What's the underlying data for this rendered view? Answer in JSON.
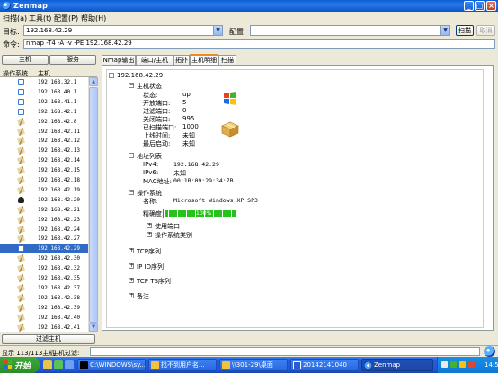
{
  "window": {
    "title": "Zenmap"
  },
  "menu": [
    "扫描(a)",
    "工具(t)",
    "配置(P)",
    "帮助(H)"
  ],
  "toolbar": {
    "target_label": "目标:",
    "target_value": "192.168.42.29",
    "profile_label": "配置:",
    "profile_value": "",
    "scan_button": "扫描",
    "cancel_button": "取消",
    "command_label": "命令:",
    "command_value": "nmap -T4 -A -v -PE 192.168.42.29"
  },
  "left_panel": {
    "hosts_button": "主机",
    "services_button": "服务",
    "col_os": "操作系统",
    "col_host": "主机",
    "filter_button": "过滤主机",
    "hosts": [
      {
        "ip": "192.168.32.1",
        "os": "windows"
      },
      {
        "ip": "192.168.40.1",
        "os": "windows"
      },
      {
        "ip": "192.168.41.1",
        "os": "windows"
      },
      {
        "ip": "192.168.42.1",
        "os": "windows"
      },
      {
        "ip": "192.168.42.8",
        "os": "unknown"
      },
      {
        "ip": "192.168.42.11",
        "os": "unknown"
      },
      {
        "ip": "192.168.42.12",
        "os": "unknown"
      },
      {
        "ip": "192.168.42.13",
        "os": "unknown"
      },
      {
        "ip": "192.168.42.14",
        "os": "unknown"
      },
      {
        "ip": "192.168.42.15",
        "os": "unknown"
      },
      {
        "ip": "192.168.42.18",
        "os": "unknown"
      },
      {
        "ip": "192.168.42.19",
        "os": "unknown"
      },
      {
        "ip": "192.168.42.20",
        "os": "linux"
      },
      {
        "ip": "192.168.42.21",
        "os": "unknown"
      },
      {
        "ip": "192.168.42.23",
        "os": "unknown"
      },
      {
        "ip": "192.168.42.24",
        "os": "unknown"
      },
      {
        "ip": "192.168.42.27",
        "os": "unknown"
      },
      {
        "ip": "192.168.42.29",
        "os": "windows",
        "selected": true
      },
      {
        "ip": "192.168.42.30",
        "os": "unknown"
      },
      {
        "ip": "192.168.42.32",
        "os": "unknown"
      },
      {
        "ip": "192.168.42.35",
        "os": "unknown"
      },
      {
        "ip": "192.168.42.37",
        "os": "unknown"
      },
      {
        "ip": "192.168.42.38",
        "os": "unknown"
      },
      {
        "ip": "192.168.42.39",
        "os": "unknown"
      },
      {
        "ip": "192.168.42.40",
        "os": "unknown"
      },
      {
        "ip": "192.168.42.41",
        "os": "unknown"
      }
    ]
  },
  "tabs": [
    "Nmap输出",
    "端口/主机",
    "拓扑",
    "主机明细",
    "扫描"
  ],
  "active_tab": 3,
  "details": {
    "host": "192.168.42.29",
    "status_section": "主机状态",
    "status": [
      {
        "label": "状态:",
        "value": "up"
      },
      {
        "label": "开放端口:",
        "value": "5"
      },
      {
        "label": "过滤端口:",
        "value": "0"
      },
      {
        "label": "关闭端口:",
        "value": "995"
      },
      {
        "label": "已扫描端口:",
        "value": "1000"
      },
      {
        "label": "上线时间:",
        "value": "未知"
      },
      {
        "label": "最后启动:",
        "value": "未知"
      }
    ],
    "address_section": "地址列表",
    "addresses": [
      {
        "label": "IPv4:",
        "value": "192.168.42.29"
      },
      {
        "label": "IPv6:",
        "value": "未知"
      },
      {
        "label": "MAC地址:",
        "value": "00:1B:09:29:34:7B"
      }
    ],
    "os_section": "操作系统",
    "os_name_label": "名称:",
    "os_name": "Microsoft Windows XP SP3",
    "accuracy_label": "精确度:",
    "accuracy_text": "100%",
    "accuracy_value": 1.0,
    "ports_used": "使用端口",
    "os_class": "操作系统类别",
    "tcp_seq": "TCP序列",
    "ipid_seq": "IP ID序列",
    "tcp_ts_seq": "TCP TS序列",
    "comment": "备注"
  },
  "statusbar": {
    "shown": "显示 113/113主机",
    "filter_label": "主机过滤:"
  },
  "taskbar": {
    "start": "开始",
    "tasks": [
      "C:\\WINDOWS\\sy...",
      "找不到用户名...",
      "\\\\301-29\\桌面",
      "20142141040",
      "Zenmap"
    ],
    "active_task": 4,
    "clock": "14:59"
  }
}
